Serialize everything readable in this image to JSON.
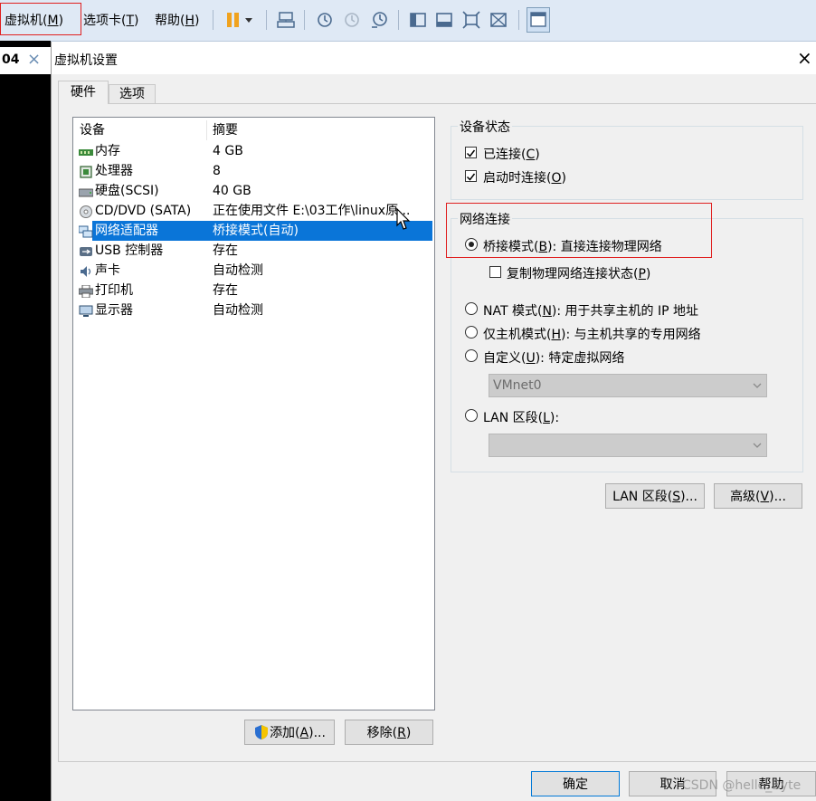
{
  "menubar": {
    "vm": "虚拟机(M)",
    "tabs": "选项卡(T)",
    "help": "帮助(H)"
  },
  "left_tab": {
    "label": "04",
    "close": "×"
  },
  "dialog": {
    "title": "虚拟机设置",
    "close": "×"
  },
  "tabs": [
    {
      "label": "硬件"
    },
    {
      "label": "选项"
    }
  ],
  "devices": {
    "header_device": "设备",
    "header_summary": "摘要",
    "items": [
      {
        "name": "内存",
        "summary": "4 GB",
        "icon": "memory-icon"
      },
      {
        "name": "处理器",
        "summary": "8",
        "icon": "processor-icon"
      },
      {
        "name": "硬盘(SCSI)",
        "summary": "40 GB",
        "icon": "hard-disk-icon"
      },
      {
        "name": "CD/DVD (SATA)",
        "summary": "正在使用文件 E:\\03工作\\linux原...",
        "icon": "cd-dvd-icon"
      },
      {
        "name": "网络适配器",
        "summary": "桥接模式(自动)",
        "icon": "network-adapter-icon"
      },
      {
        "name": "USB 控制器",
        "summary": "存在",
        "icon": "usb-icon"
      },
      {
        "name": "声卡",
        "summary": "自动检测",
        "icon": "sound-card-icon"
      },
      {
        "name": "打印机",
        "summary": "存在",
        "icon": "printer-icon"
      },
      {
        "name": "显示器",
        "summary": "自动检测",
        "icon": "display-icon"
      }
    ],
    "selected_index": 4
  },
  "buttons": {
    "add": "添加(A)...",
    "remove": "移除(R)",
    "lan_segment": "LAN 区段(S)...",
    "advanced": "高级(V)...",
    "ok": "确定",
    "cancel": "取消",
    "help": "帮助"
  },
  "device_status": {
    "title": "设备状态",
    "connected": {
      "label": "已连接(C)",
      "checked": true
    },
    "connect_at_power_on": {
      "label": "启动时连接(O)",
      "checked": true
    }
  },
  "network_connection": {
    "title": "网络连接",
    "bridged": {
      "label": "桥接模式(B): 直接连接物理网络",
      "selected": true
    },
    "replicate": {
      "label": "复制物理网络连接状态(P)",
      "checked": false
    },
    "nat": {
      "label": "NAT 模式(N): 用于共享主机的 IP 地址",
      "selected": false
    },
    "host_only": {
      "label": "仅主机模式(H): 与主机共享的专用网络",
      "selected": false
    },
    "custom": {
      "label": "自定义(U): 特定虚拟网络",
      "selected": false
    },
    "custom_value": "VMnet0",
    "lan_segment": {
      "label": "LAN 区段(L):",
      "selected": false
    },
    "lan_value": ""
  },
  "watermark": "CSDN @hello_Byte",
  "colors": {
    "selection": "#0a75d8",
    "highlight_box": "#e02020",
    "toolbar_bg": "#dfe9f5"
  }
}
